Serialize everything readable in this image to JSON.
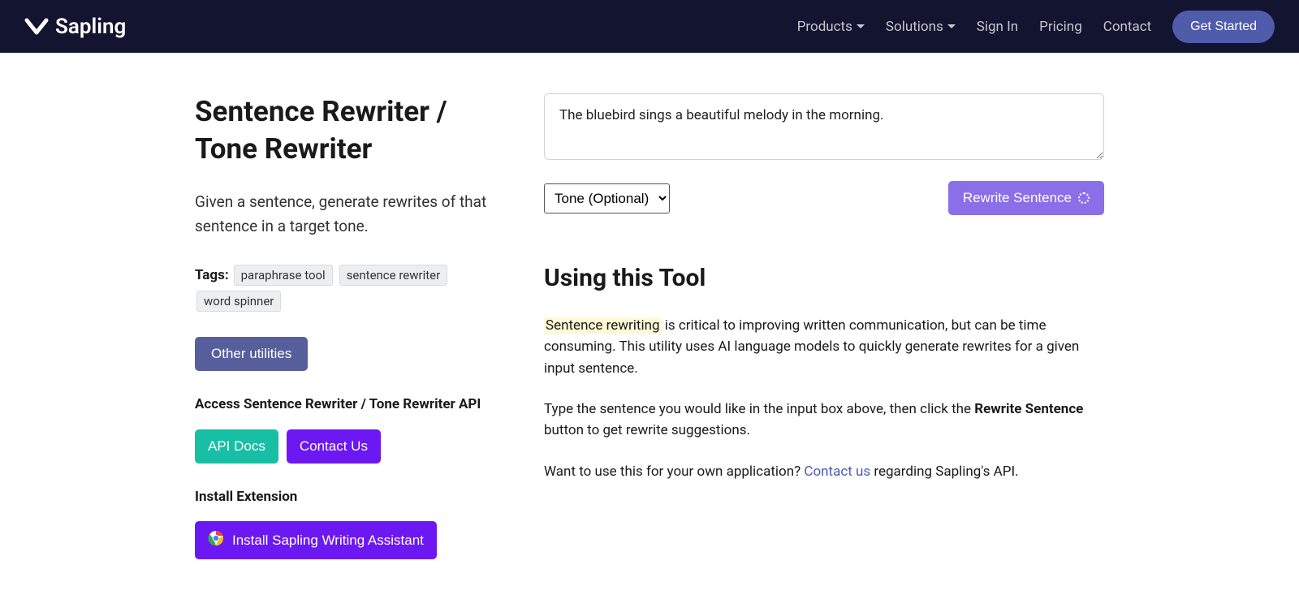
{
  "nav": {
    "brand": "Sapling",
    "products": "Products",
    "solutions": "Solutions",
    "signin": "Sign In",
    "pricing": "Pricing",
    "contact": "Contact",
    "get_started": "Get Started"
  },
  "left": {
    "title": "Sentence Rewriter / Tone Rewriter",
    "subtitle": "Given a sentence, generate rewrites of that sentence in a target tone.",
    "tags_label": "Tags",
    "tags": [
      "paraphrase tool",
      "sentence rewriter",
      "word spinner"
    ],
    "other_utilities": "Other utilities",
    "access_api": "Access Sentence Rewriter / Tone Rewriter API",
    "api_docs": "API Docs",
    "contact_us": "Contact Us",
    "install_extension": "Install Extension",
    "install_sapling": "Install Sapling Writing Assistant"
  },
  "right": {
    "input_value": "The bluebird sings a beautiful melody in the morning.",
    "tone_option": "Tone (Optional)",
    "rewrite_button": "Rewrite Sentence",
    "using_title": "Using this Tool",
    "p1_highlight": "Sentence rewriting",
    "p1_rest": " is critical to improving written communication, but can be time consuming. This utility uses AI language models to quickly generate rewrites for a given input sentence.",
    "p2_a": "Type the sentence you would like in the input box above, then click the ",
    "p2_strong": "Rewrite Sentence",
    "p2_b": " button to get rewrite suggestions.",
    "p3_a": "Want to use this for your own application? ",
    "p3_link": "Contact us",
    "p3_b": " regarding Sapling's API."
  }
}
